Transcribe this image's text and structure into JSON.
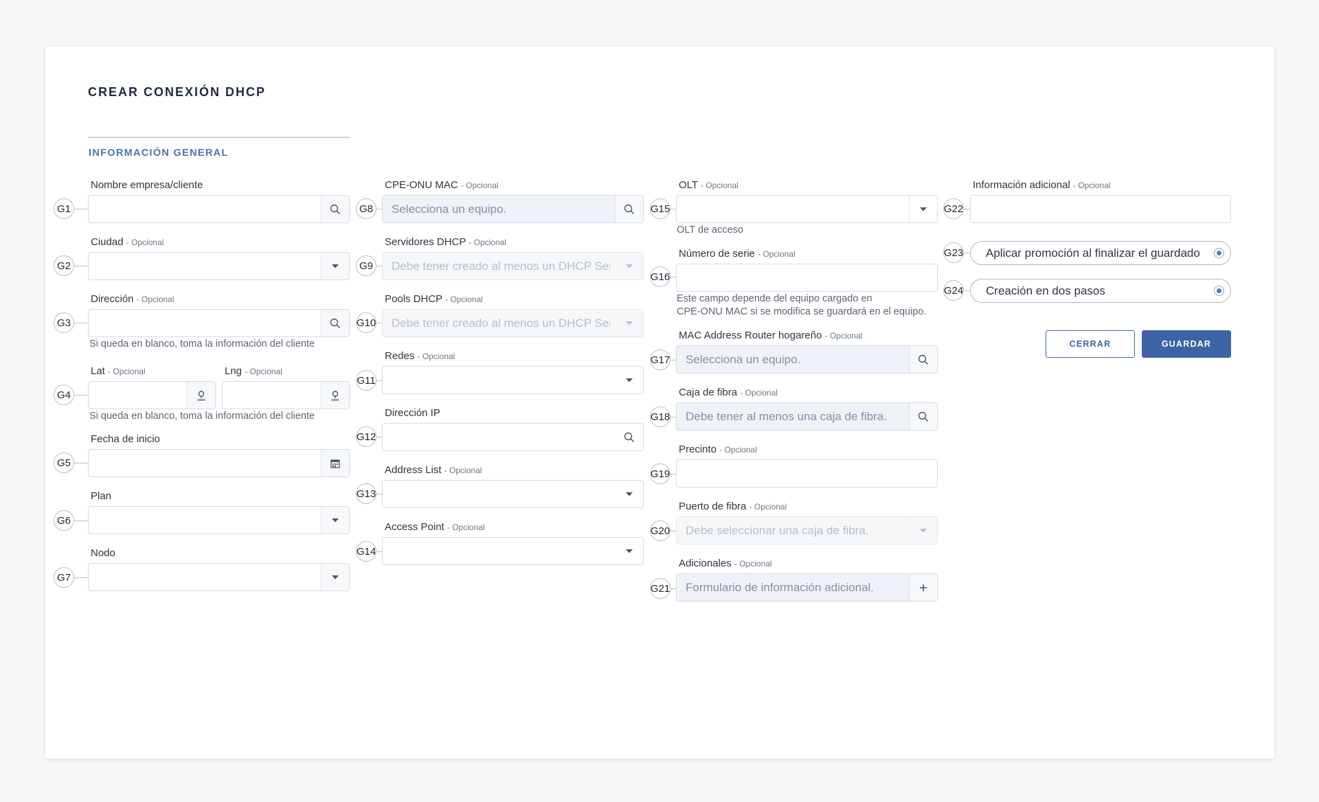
{
  "title": "CREAR CONEXIÓN DHCP",
  "section": "INFORMACIÓN GENERAL",
  "optional": "- Opcional",
  "help_blank": "Si queda en blanco, toma la información del cliente",
  "fields": {
    "g1": {
      "badge": "G1",
      "label": "Nombre empresa/cliente",
      "value": "",
      "icon": "search-icon"
    },
    "g2": {
      "badge": "G2",
      "label": "Ciudad",
      "value": "",
      "icon": "chevron-down-icon"
    },
    "g3": {
      "badge": "G3",
      "label": "Dirección",
      "value": "",
      "icon": "search-icon"
    },
    "g4": {
      "badge": "G4",
      "lat_label": "Lat",
      "lng_label": "Lng",
      "icon": "map-pin-icon"
    },
    "g5": {
      "badge": "G5",
      "label": "Fecha de inicio",
      "value": "",
      "icon": "calendar-icon"
    },
    "g6": {
      "badge": "G6",
      "label": "Plan",
      "value": "",
      "icon": "chevron-down-icon"
    },
    "g7": {
      "badge": "G7",
      "label": "Nodo",
      "value": "",
      "icon": "chevron-down-icon"
    },
    "g8": {
      "badge": "G8",
      "label": "CPE-ONU MAC",
      "placeholder": "Selecciona un equipo.",
      "icon": "search-icon"
    },
    "g9": {
      "badge": "G9",
      "label": "Servidores DHCP",
      "placeholder": "Debe tener creado al menos un DHCP Server.",
      "icon": "chevron-down-icon"
    },
    "g10": {
      "badge": "G10",
      "label": "Pools DHCP",
      "placeholder": "Debe tener creado al menos un DHCP Server.",
      "icon": "chevron-down-icon"
    },
    "g11": {
      "badge": "G11",
      "label": "Redes",
      "value": "",
      "icon": "chevron-down-icon"
    },
    "g12": {
      "badge": "G12",
      "label": "Dirección IP",
      "value": "",
      "icon": "search-icon"
    },
    "g13": {
      "badge": "G13",
      "label": "Address List",
      "value": "",
      "icon": "chevron-down-icon"
    },
    "g14": {
      "badge": "G14",
      "label": "Access Point",
      "value": "",
      "icon": "chevron-down-icon"
    },
    "g15": {
      "badge": "G15",
      "label": "OLT",
      "value": "",
      "help": "OLT de acceso",
      "icon": "chevron-down-icon"
    },
    "g16": {
      "badge": "G16",
      "label": "Número de serie",
      "value": "",
      "help1": "Este campo depende del equipo cargado en",
      "help2": "CPE-ONU MAC si se modifica se guardará en el equipo."
    },
    "g17": {
      "badge": "G17",
      "label": "MAC Address Router hogareño",
      "placeholder": "Selecciona un equipo.",
      "icon": "search-icon"
    },
    "g18": {
      "badge": "G18",
      "label": "Caja de fibra",
      "placeholder": "Debe tener al menos una caja de fibra.",
      "icon": "search-icon"
    },
    "g19": {
      "badge": "G19",
      "label": "Precinto",
      "value": ""
    },
    "g20": {
      "badge": "G20",
      "label": "Puerto de fibra",
      "placeholder": "Debe seleccionar una caja de fibra.",
      "icon": "chevron-down-icon"
    },
    "g21": {
      "badge": "G21",
      "label": "Adicionales",
      "placeholder": "Formulario de información adicional.",
      "icon": "plus-icon"
    },
    "g22": {
      "badge": "G22",
      "label": "Información adicional",
      "value": ""
    },
    "g23": {
      "badge": "G23",
      "label": "Aplicar promoción al finalizar el guardado",
      "selected": true
    },
    "g24": {
      "badge": "G24",
      "label": "Creación en dos pasos",
      "selected": true
    }
  },
  "buttons": {
    "close": "CERRAR",
    "save": "GUARDAR"
  },
  "colors": {
    "accent": "#3b63a6",
    "section": "#4a76a8",
    "tinted_input": "#eff2f8"
  }
}
